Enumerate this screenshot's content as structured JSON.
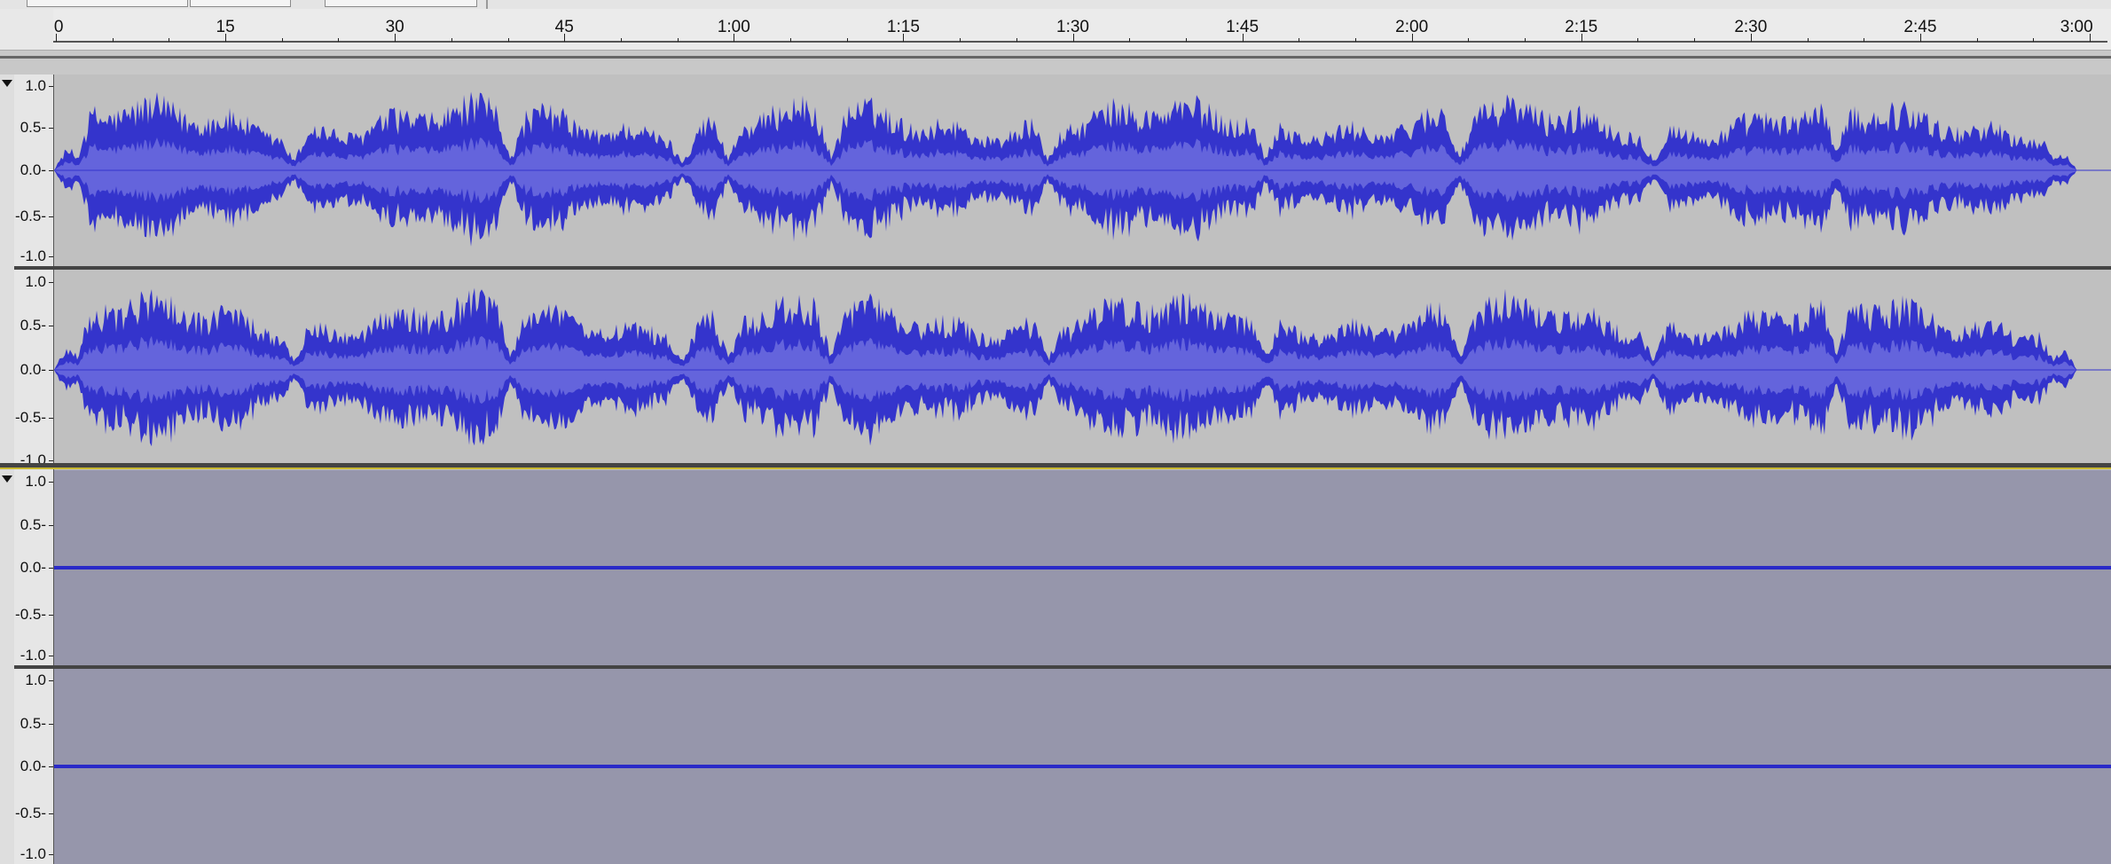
{
  "window": {
    "section": "audio-editor-tracks"
  },
  "timeline": {
    "labels": [
      "0",
      "15",
      "30",
      "45",
      "1:00",
      "1:15",
      "1:30",
      "1:45",
      "2:00",
      "2:15",
      "2:30",
      "2:45",
      "3:00"
    ]
  },
  "tracks": [
    {
      "name": "track-1-stereo",
      "state": "selected",
      "colors": {
        "background": "#c0c0c0",
        "wave_peak": "#3434cc",
        "wave_rms": "#6464dc",
        "centerline": "#3434cc"
      },
      "channels": [
        {
          "scale": [
            "1.0",
            "0.5-",
            "0.0-",
            "-0.5-",
            "-1.0"
          ]
        },
        {
          "scale": [
            "1.0",
            "0.5-",
            "0.0-",
            "-0.5-",
            "-1.0"
          ]
        }
      ],
      "audio_length": "2:57"
    },
    {
      "name": "track-2-stereo",
      "state": "unselected-silent",
      "colors": {
        "background": "#9696ab",
        "centerline": "#2a2ac8"
      },
      "channels": [
        {
          "scale": [
            "1.0",
            "0.5-",
            "0.0-",
            "-0.5-",
            "-1.0"
          ]
        },
        {
          "scale": [
            "1.0",
            "0.5-",
            "0.0-",
            "-0.5-",
            "-1.0"
          ]
        }
      ]
    }
  ]
}
